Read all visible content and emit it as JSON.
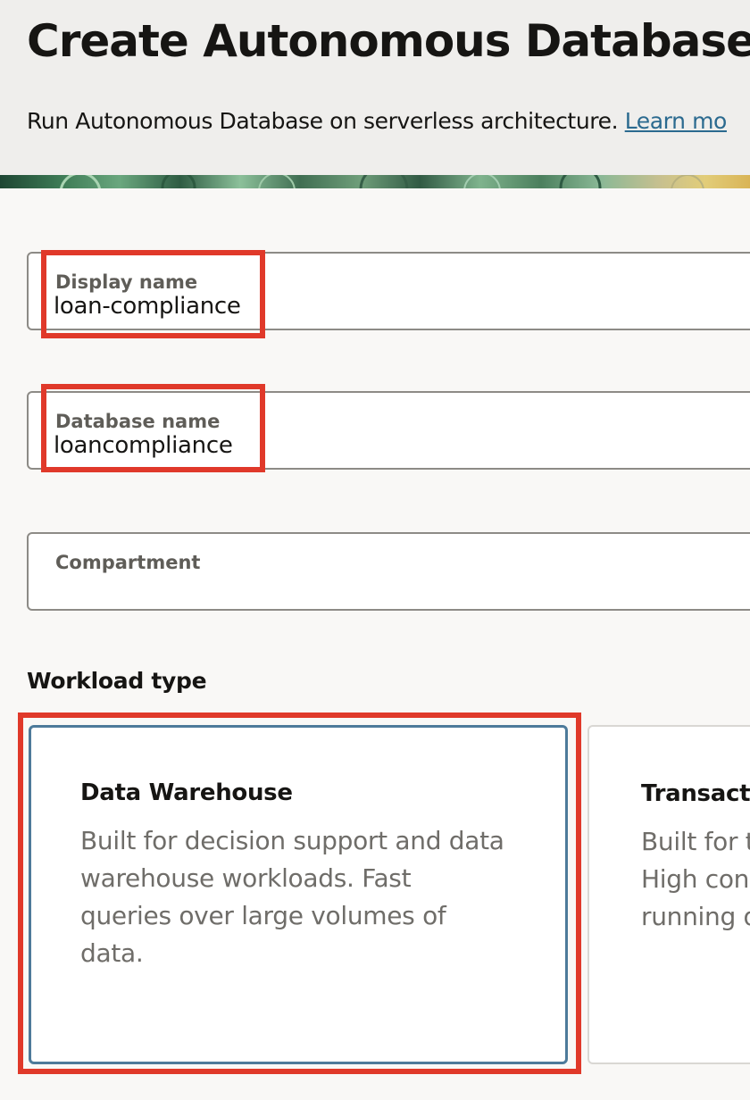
{
  "header": {
    "title": "Create Autonomous Database",
    "subtitle": "Run Autonomous Database on serverless architecture.",
    "learn_more": "Learn mo"
  },
  "form": {
    "display_name": {
      "label": "Display name",
      "value": "loan-compliance"
    },
    "database_name": {
      "label": "Database name",
      "value": "loancompliance"
    },
    "compartment": {
      "label": "Compartment",
      "value": ""
    }
  },
  "workload": {
    "label": "Workload type",
    "cards": [
      {
        "title": "Data Warehouse",
        "lines": [
          "Built for decision support and data",
          "warehouse workloads. Fast",
          "queries over large volumes of",
          "data."
        ],
        "selected": true
      },
      {
        "title": "Transacti",
        "lines": [
          "Built for t",
          "High con",
          "running q"
        ],
        "selected": false
      }
    ]
  },
  "colors": {
    "highlight": "#e0392a",
    "selected_border": "#4d7a9a",
    "link": "#2b6a8f"
  }
}
